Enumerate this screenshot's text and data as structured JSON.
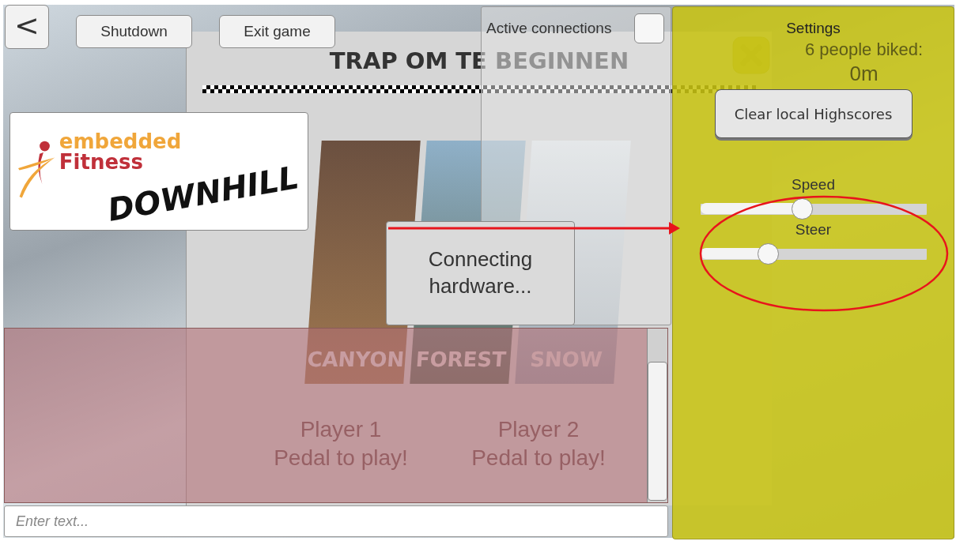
{
  "nav": {
    "back_button": "<"
  },
  "top_buttons": [
    {
      "label": "Shutdown"
    },
    {
      "label": "Exit game"
    }
  ],
  "logo": {
    "brand_line_1": "embedded",
    "brand_line_2": "Fitness",
    "product": "DOWNHILL"
  },
  "menu": {
    "title": "TRAP OM TE BEGINNEN",
    "levels": [
      {
        "label": "CANYON"
      },
      {
        "label": "FOREST"
      },
      {
        "label": "SNOW"
      }
    ],
    "players": [
      {
        "name": "Player 1",
        "prompt": "Pedal to play!"
      },
      {
        "name": "Player 2",
        "prompt": "Pedal to play!"
      }
    ]
  },
  "stats": {
    "label": "6 people biked:",
    "value": "0m"
  },
  "connections": {
    "title": "Active connections",
    "checked": false
  },
  "dialog": {
    "message": "Connecting hardware..."
  },
  "settings": {
    "title": "Settings",
    "clear_button": "Clear local Highscores",
    "sliders": [
      {
        "label": "Speed",
        "level": 0.45
      },
      {
        "label": "Steer",
        "level": 0.3
      }
    ]
  },
  "console": {
    "placeholder": "Enter text..."
  }
}
